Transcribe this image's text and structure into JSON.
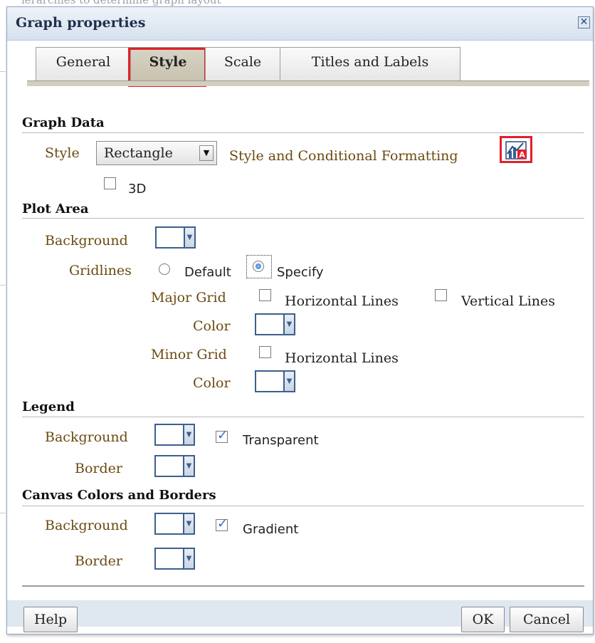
{
  "background": {
    "partial_text": "ierarchies to determine graph layout"
  },
  "dialog": {
    "title": "Graph properties",
    "close_icon": "close-icon",
    "tabs": [
      {
        "label": "General",
        "active": false
      },
      {
        "label": "Style",
        "active": true
      },
      {
        "label": "Scale",
        "active": false
      },
      {
        "label": "Titles and Labels",
        "active": false
      }
    ]
  },
  "graph_data": {
    "heading": "Graph Data",
    "style_label": "Style",
    "style_value": "Rectangle",
    "conditional_formatting_label": "Style and Conditional Formatting",
    "conditional_formatting_icon": "chart-format-icon",
    "three_d_label": "3D",
    "three_d_checked": false
  },
  "plot_area": {
    "heading": "Plot Area",
    "background_label": "Background",
    "gridlines_label": "Gridlines",
    "gridlines_options": [
      "Default",
      "Specify"
    ],
    "gridlines_selected": "Specify",
    "major_grid_label": "Major Grid",
    "major_horizontal_label": "Horizontal Lines",
    "major_vertical_label": "Vertical Lines",
    "major_color_label": "Color",
    "minor_grid_label": "Minor Grid",
    "minor_horizontal_label": "Horizontal Lines",
    "minor_color_label": "Color"
  },
  "legend": {
    "heading": "Legend",
    "background_label": "Background",
    "transparent_label": "Transparent",
    "transparent_checked": true,
    "border_label": "Border"
  },
  "canvas": {
    "heading": "Canvas Colors and Borders",
    "background_label": "Background",
    "gradient_label": "Gradient",
    "gradient_checked": true,
    "border_label": "Border"
  },
  "footer": {
    "help_label": "Help",
    "ok_label": "OK",
    "cancel_label": "Cancel"
  },
  "colors": {
    "highlight": "#e0212b",
    "label": "#6b4a10",
    "accent": "#2f6fd0"
  }
}
